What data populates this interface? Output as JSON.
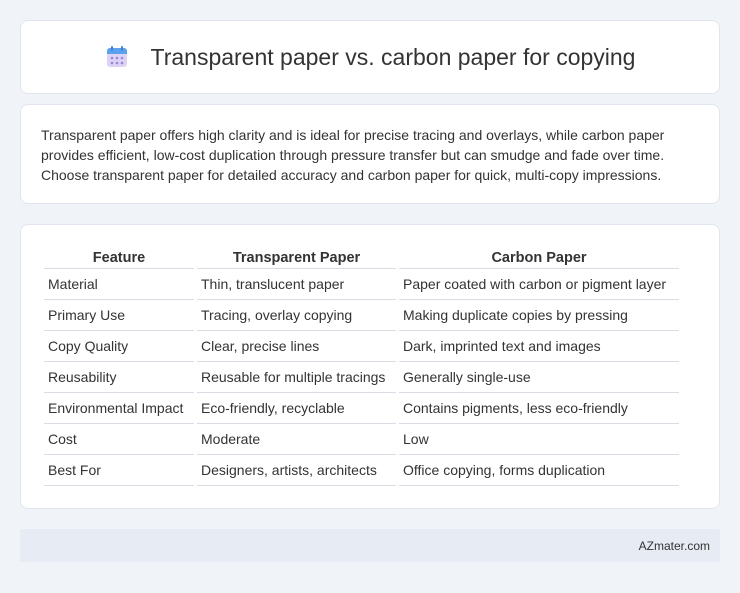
{
  "header": {
    "title": "Transparent paper vs. carbon paper for copying",
    "icon": "calendar-icon"
  },
  "summary": {
    "text": "Transparent paper offers high clarity and is ideal for precise tracing and overlays, while carbon paper provides efficient, low-cost duplication through pressure transfer but can smudge and fade over time. Choose transparent paper for detailed accuracy and carbon paper for quick, multi-copy impressions."
  },
  "table": {
    "headers": [
      "Feature",
      "Transparent Paper",
      "Carbon Paper"
    ],
    "rows": [
      [
        "Material",
        "Thin, translucent paper",
        "Paper coated with carbon or pigment layer"
      ],
      [
        "Primary Use",
        "Tracing, overlay copying",
        "Making duplicate copies by pressing"
      ],
      [
        "Copy Quality",
        "Clear, precise lines",
        "Dark, imprinted text and images"
      ],
      [
        "Reusability",
        "Reusable for multiple tracings",
        "Generally single-use"
      ],
      [
        "Environmental Impact",
        "Eco-friendly, recyclable",
        "Contains pigments, less eco-friendly"
      ],
      [
        "Cost",
        "Moderate",
        "Low"
      ],
      [
        "Best For",
        "Designers, artists, architects",
        "Office copying, forms duplication"
      ]
    ]
  },
  "footer": {
    "text": "AZmater.com"
  }
}
